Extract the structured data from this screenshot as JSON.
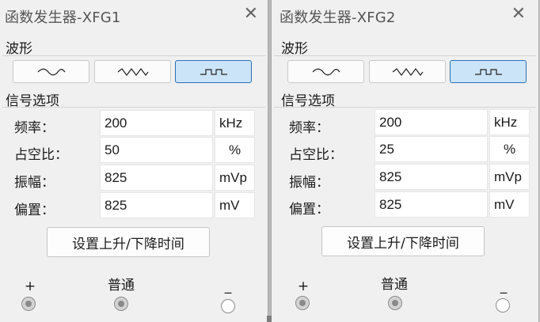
{
  "generators": [
    {
      "title": "函数发生器-XFG1",
      "waveform_section": "波形",
      "waveforms": [
        "sine",
        "triangle",
        "square"
      ],
      "selected_waveform": "square",
      "signal_section": "信号选项",
      "params": [
        {
          "label": "频率：",
          "value": "200",
          "unit": "kHz"
        },
        {
          "label": "占空比：",
          "value": "50",
          "unit": "%"
        },
        {
          "label": "振幅：",
          "value": "825",
          "unit": "mVp"
        },
        {
          "label": "偏置：",
          "value": "825",
          "unit": "mV"
        }
      ],
      "rise_fall_button": "设置上升/下降时间",
      "terminals": {
        "plus": "+",
        "common": "普通",
        "minus": "_"
      }
    },
    {
      "title": "函数发生器-XFG2",
      "waveform_section": "波形",
      "waveforms": [
        "sine",
        "triangle",
        "square"
      ],
      "selected_waveform": "square",
      "signal_section": "信号选项",
      "params": [
        {
          "label": "频率：",
          "value": "200",
          "unit": "kHz"
        },
        {
          "label": "占空比：",
          "value": "25",
          "unit": "%"
        },
        {
          "label": "振幅：",
          "value": "825",
          "unit": "mVp"
        },
        {
          "label": "偏置：",
          "value": "825",
          "unit": "mV"
        }
      ],
      "rise_fall_button": "设置上升/下降时间",
      "terminals": {
        "plus": "+",
        "common": "普通",
        "minus": "_"
      }
    }
  ],
  "icons": {
    "close": "close-icon",
    "sine": "sine-wave-icon",
    "triangle": "triangle-wave-icon",
    "square": "square-wave-icon"
  }
}
